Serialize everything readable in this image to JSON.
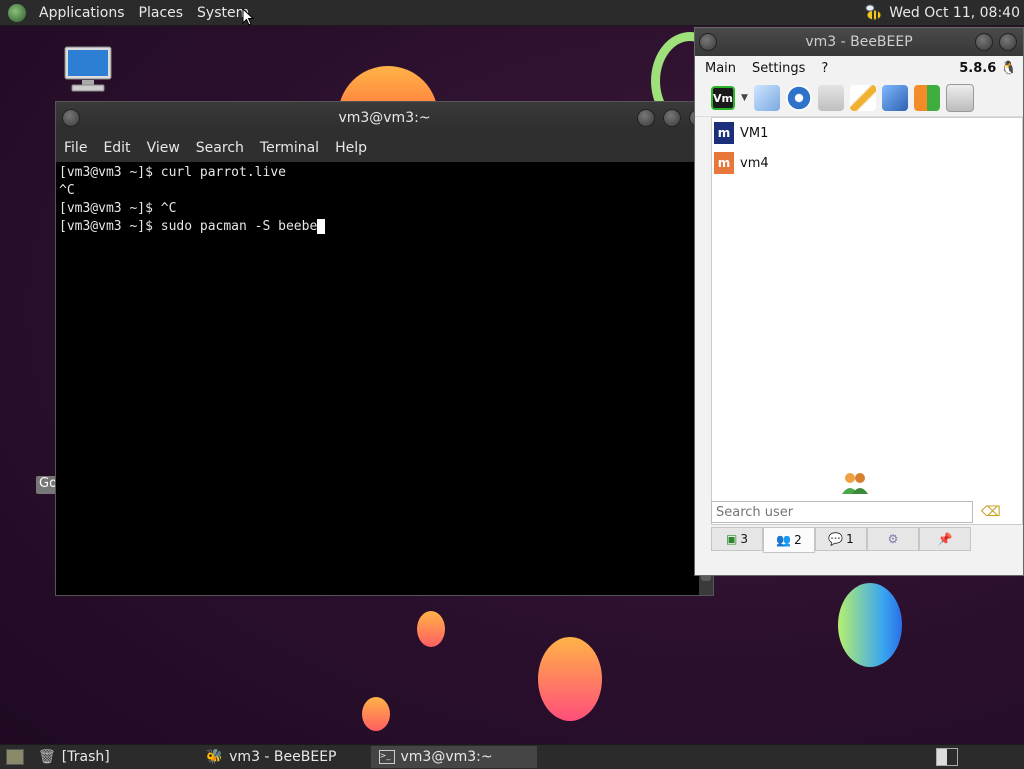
{
  "top_panel": {
    "menus": [
      "Applications",
      "Places",
      "System"
    ],
    "clock": "Wed Oct 11, 08:40"
  },
  "desktop": {
    "partial_label": "Go"
  },
  "terminal": {
    "title": "vm3@vm3:~",
    "menus": [
      "File",
      "Edit",
      "View",
      "Search",
      "Terminal",
      "Help"
    ],
    "lines": [
      "[vm3@vm3 ~]$ curl parrot.live",
      "^C",
      "[vm3@vm3 ~]$ ^C",
      "[vm3@vm3 ~]$ sudo pacman -S beebe"
    ]
  },
  "beebeep": {
    "title": "vm3 - BeeBEEP",
    "menus": [
      "Main",
      "Settings",
      "?"
    ],
    "version": "5.8.6",
    "users": [
      {
        "name": "VM1",
        "avatar": "m",
        "color": "#1b2f7a"
      },
      {
        "name": "vm4",
        "avatar": "m",
        "color": "#e8773a"
      }
    ],
    "search_placeholder": "Search user",
    "tabs": [
      {
        "count": "3",
        "icon": "computer-icon"
      },
      {
        "count": "2",
        "icon": "users-icon"
      },
      {
        "count": "1",
        "icon": "chat-icon"
      },
      {
        "count": "",
        "icon": "groups-icon"
      },
      {
        "count": "",
        "icon": "pin-icon"
      }
    ]
  },
  "bottom_panel": {
    "tasks": [
      "[Trash]",
      "vm3 - BeeBEEP",
      "vm3@vm3:~"
    ]
  }
}
